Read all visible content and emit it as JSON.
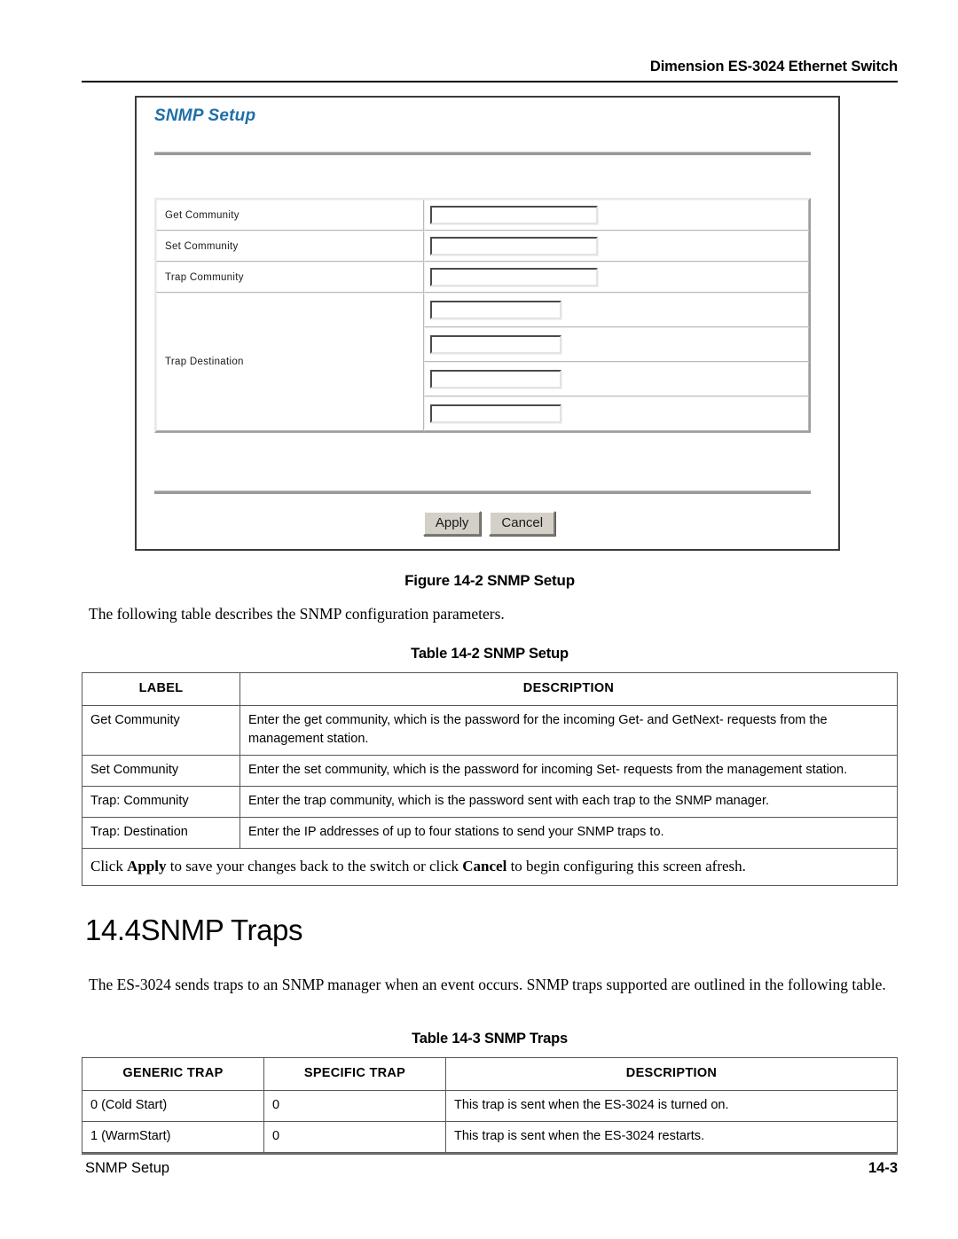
{
  "header": {
    "running_head": "Dimension ES-3024 Ethernet Switch"
  },
  "figure": {
    "panel_title": "SNMP Setup",
    "fields": [
      {
        "label": "Get Community",
        "value": "",
        "placeholder": ""
      },
      {
        "label": "Set Community",
        "value": "",
        "placeholder": ""
      },
      {
        "label": "Trap Community",
        "value": "",
        "placeholder": ""
      }
    ],
    "trap_destination": {
      "label": "Trap Destination",
      "inputs": [
        {
          "value": "",
          "placeholder": ""
        },
        {
          "value": "",
          "placeholder": ""
        },
        {
          "value": "",
          "placeholder": ""
        },
        {
          "value": "",
          "placeholder": ""
        }
      ]
    },
    "buttons": {
      "apply": "Apply",
      "cancel": "Cancel"
    },
    "caption": "Figure 14-2 SNMP Setup"
  },
  "intro_text": "The following table describes the SNMP configuration parameters.",
  "table_142": {
    "caption": "Table 14-2 SNMP Setup",
    "headers": [
      "LABEL",
      "DESCRIPTION"
    ],
    "rows": [
      {
        "label": "Get Community",
        "description": "Enter the get community, which is the password for the incoming Get- and GetNext- requests from the management station."
      },
      {
        "label": "Set Community",
        "description": "Enter the set community, which is the password for incoming Set- requests from the management station."
      },
      {
        "label": "Trap: Community",
        "description": "Enter the trap community, which is the password sent with each trap to the SNMP manager."
      },
      {
        "label": "Trap: Destination",
        "description": "Enter the IP addresses of up to four stations to send your SNMP traps to."
      }
    ],
    "note": {
      "part1": "Click ",
      "bold1": "Apply",
      "part2": " to save your changes back to the switch or click ",
      "bold2": "Cancel",
      "part3": " to begin configuring this screen afresh."
    }
  },
  "section": {
    "number": "14.4",
    "title": "SNMP Traps",
    "heading": "14.4SNMP Traps",
    "body": "The ES-3024 sends traps to an SNMP manager when an event occurs. SNMP traps supported are outlined in the following table."
  },
  "table_143": {
    "caption": "Table 14-3 SNMP Traps",
    "headers": [
      "GENERIC TRAP",
      "SPECIFIC TRAP",
      "DESCRIPTION"
    ],
    "rows": [
      {
        "generic": "0 (Cold Start)",
        "specific": "0",
        "description": "This trap is sent when the ES-3024 is turned on."
      },
      {
        "generic": "1 (WarmStart)",
        "specific": "0",
        "description": "This trap is sent when the ES-3024 restarts."
      }
    ]
  },
  "footer": {
    "left": "SNMP Setup",
    "page": "14-3"
  },
  "colors": {
    "panel_title": "#1f6fa8",
    "button_face": "#d4d0c8",
    "table_border": "#575757",
    "rule": "#000000"
  }
}
